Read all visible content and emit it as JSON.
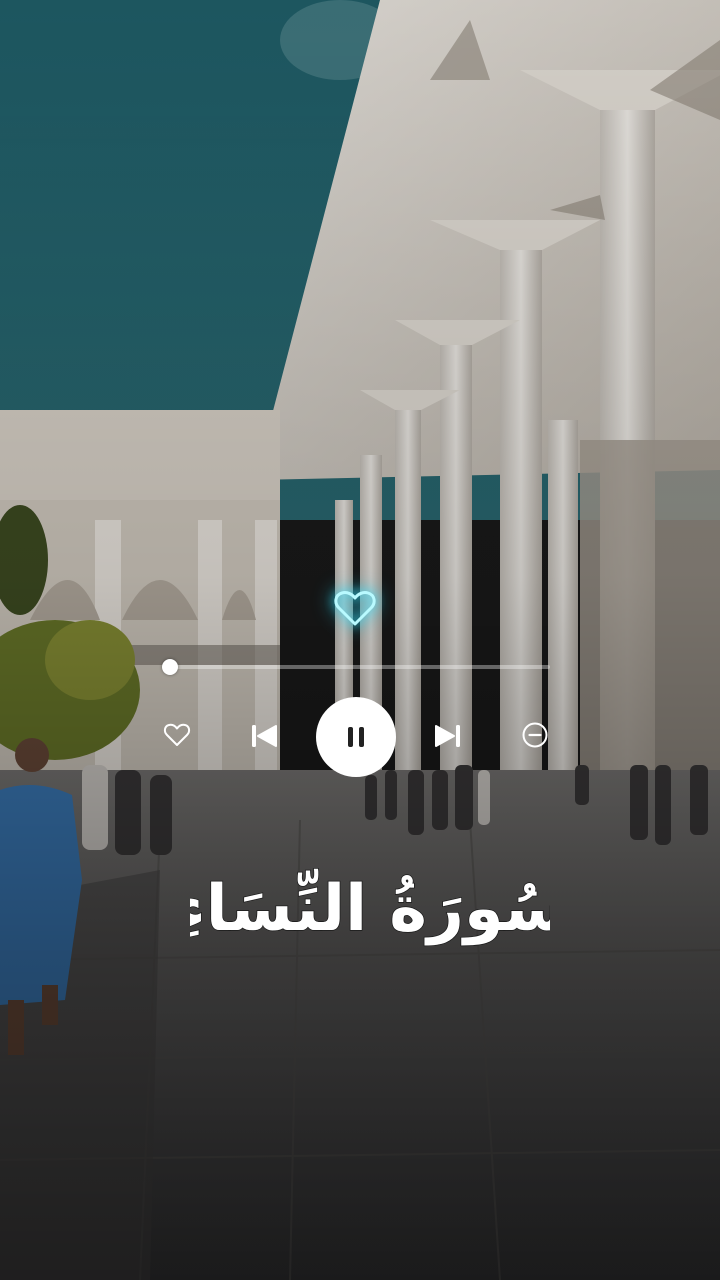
{
  "player": {
    "progress_fraction": 0.0,
    "is_playing": true,
    "favorite_icon": "heart-icon",
    "glow_icon": "glowing-heart-icon",
    "prev_icon": "skip-previous-icon",
    "play_pause_icon": "pause-icon",
    "next_icon": "skip-next-icon",
    "remove_icon": "minus-circle-icon",
    "glow_color": "#8ff4ff"
  },
  "surah": {
    "title": "سُورَةُ النِّسَاءِ"
  },
  "colors": {
    "sky": "#1e5c66",
    "stone": "#d9d4cc",
    "accent": "#ffffff"
  }
}
